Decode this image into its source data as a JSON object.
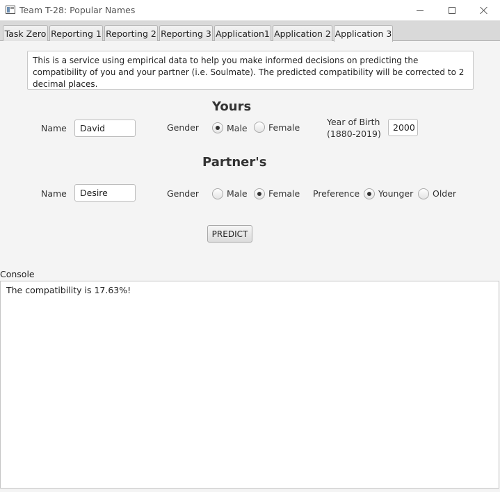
{
  "window": {
    "title": "Team T-28: Popular Names"
  },
  "tabs": [
    {
      "label": "Task Zero"
    },
    {
      "label": "Reporting 1"
    },
    {
      "label": "Reporting 2"
    },
    {
      "label": "Reporting 3"
    },
    {
      "label": "Application1"
    },
    {
      "label": "Application 2"
    },
    {
      "label": "Application 3",
      "active": true
    }
  ],
  "description": "This is a service using empirical data to help you make informed decisions on predicting the compatibility of you and your partner (i.e. Soulmate). The predicted compatibility will be corrected to 2 decimal places.",
  "yours": {
    "heading": "Yours",
    "name_label": "Name",
    "name_value": "David",
    "gender_label": "Gender",
    "gender_options": [
      "Male",
      "Female"
    ],
    "gender_selected": "Male",
    "yob_label": "Year of Birth",
    "yob_range": "(1880-2019)",
    "yob_value": "2000"
  },
  "partner": {
    "heading": "Partner's",
    "name_label": "Name",
    "name_value": "Desire",
    "gender_label": "Gender",
    "gender_options": [
      "Male",
      "Female"
    ],
    "gender_selected": "Female",
    "preference_label": "Preference",
    "preference_options": [
      "Younger",
      "Older"
    ],
    "preference_selected": "Younger"
  },
  "predict_label": "PREDICT",
  "console": {
    "label": "Console",
    "output": "The compatibility is 17.63%!"
  }
}
